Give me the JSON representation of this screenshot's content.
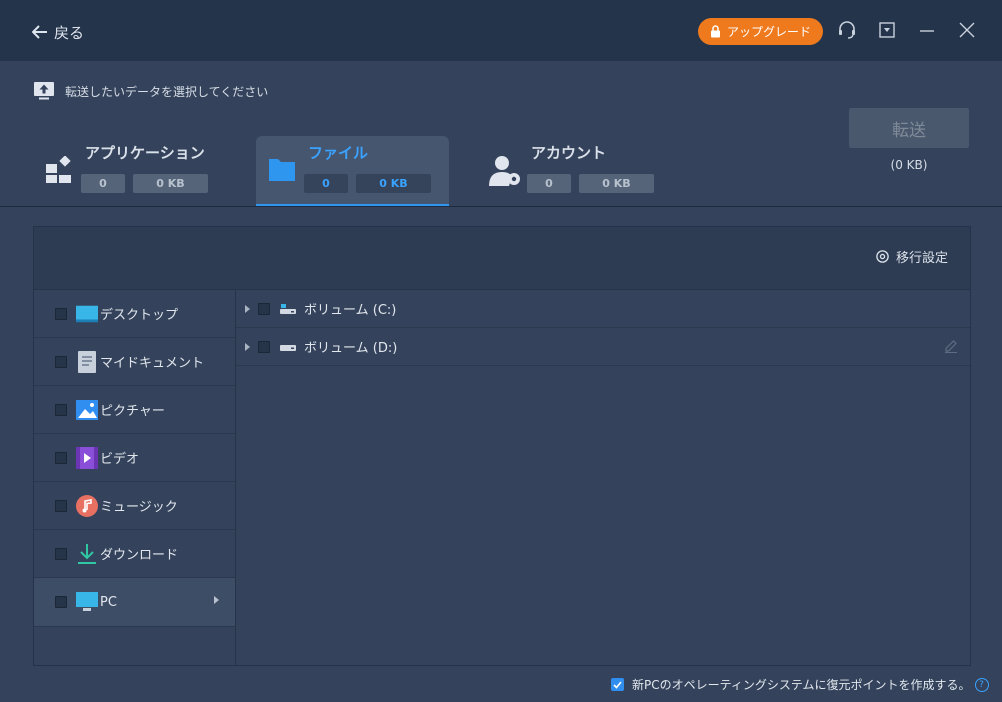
{
  "titlebar": {
    "back_label": "戻る",
    "upgrade_label": "アップグレード"
  },
  "header": {
    "prompt": "転送したいデータを選択してください",
    "tabs": [
      {
        "label": "アプリケーション",
        "count": "0",
        "size": "0 KB"
      },
      {
        "label": "ファイル",
        "count": "0",
        "size": "0 KB"
      },
      {
        "label": "アカウント",
        "count": "0",
        "size": "0 KB"
      }
    ],
    "transfer_label": "転送",
    "transfer_size": "(0 KB)"
  },
  "panel": {
    "settings_label": "移行設定",
    "sidebar": [
      {
        "label": "デスクトップ",
        "icon": "desktop-icon"
      },
      {
        "label": "マイドキュメント",
        "icon": "document-icon"
      },
      {
        "label": "ピクチャー",
        "icon": "picture-icon"
      },
      {
        "label": "ビデオ",
        "icon": "video-icon"
      },
      {
        "label": "ミュージック",
        "icon": "music-icon"
      },
      {
        "label": "ダウンロード",
        "icon": "download-icon"
      },
      {
        "label": "PC",
        "icon": "pc-icon"
      }
    ],
    "drives": [
      {
        "label": "ボリューム (C:)"
      },
      {
        "label": "ボリューム (D:)"
      }
    ]
  },
  "footer": {
    "restore_point_label": "新PCのオペレーティングシステムに復元ポイントを作成する。",
    "help_glyph": "?"
  },
  "colors": {
    "accent": "#3aa2ff",
    "upgrade": "#ee7a1d",
    "titlebar": "#24344b",
    "background": "#34435b"
  }
}
